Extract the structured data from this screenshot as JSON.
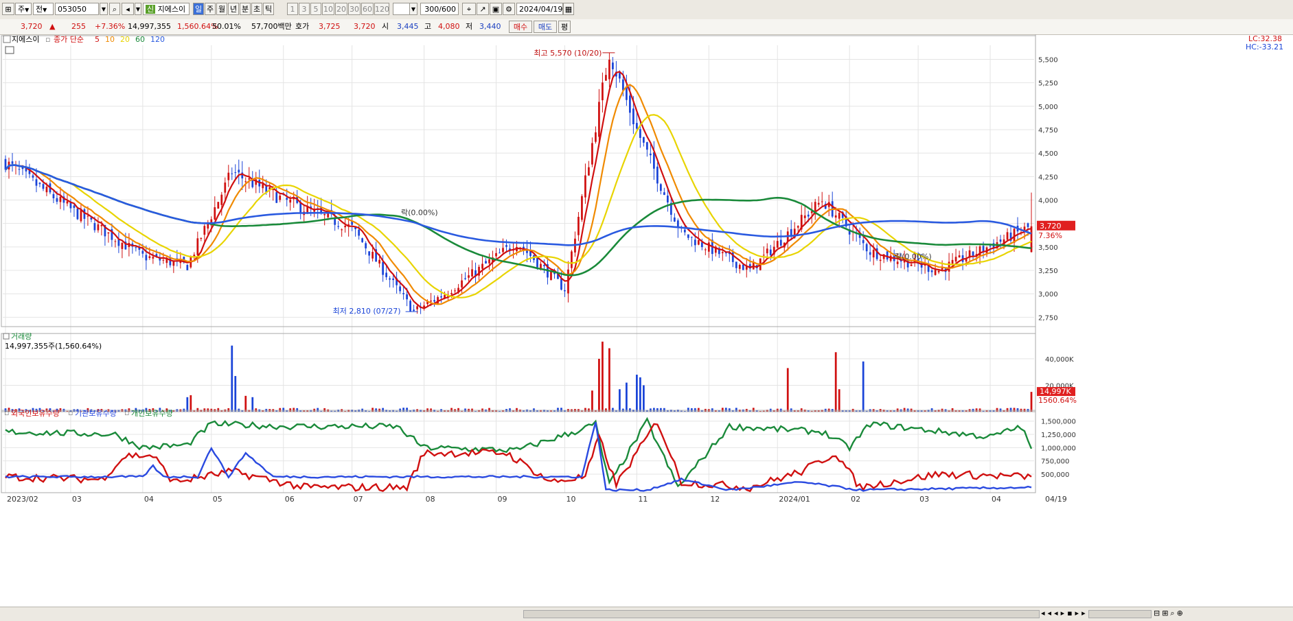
{
  "toolbar": {
    "period_label": "주",
    "market_label": "전",
    "code": "053050",
    "stock_name": "지에스이",
    "stock_badge": "신",
    "intervals": [
      "일",
      "주",
      "월",
      "년",
      "분",
      "초",
      "틱"
    ],
    "selected_interval": "일",
    "minute_steps": [
      "1",
      "3",
      "5",
      "10",
      "20",
      "30",
      "60",
      "120"
    ],
    "bar_count": "300/600",
    "date": "2024/04/19"
  },
  "quote": {
    "price": "3,720",
    "change_arrow": "▲",
    "change": "255",
    "change_pct": "+7.36%",
    "volume": "14,997,355",
    "volume_ratio": "1,560.64%",
    "turnover_pct": "50.01%",
    "amount": "57,700백만",
    "bid_label": "호가",
    "ask_price": "3,725",
    "bid_price": "3,720",
    "open_label": "시",
    "open": "3,445",
    "high_label": "고",
    "high": "4,080",
    "low_label": "저",
    "low": "3,440",
    "buy_label": "매수",
    "sell_label": "매도",
    "eval_label": "평"
  },
  "price_pane": {
    "legend_name": "지에스이",
    "legend_ma_prefix": "종가 단순",
    "legend_ma": [
      {
        "label": "5",
        "color": "#d01010"
      },
      {
        "label": "10",
        "color": "#f08a00"
      },
      {
        "label": "20",
        "color": "#e8d400"
      },
      {
        "label": "60",
        "color": "#1a8a3a"
      },
      {
        "label": "120",
        "color": "#2a5ae0"
      }
    ],
    "lc": "LC:32.38",
    "hc": "HC:-33.21",
    "max_label": "최고 5,570 (10/20)",
    "min_label": "최저 2,810 (07/27)",
    "annot1": "락(0.00%)",
    "annot2": "락(0.00%)",
    "price_tag": "3,720",
    "price_tag_pct": "7.36%"
  },
  "volume_pane": {
    "title": "거래량",
    "value_label": "14,997,355주(1,560.64%)",
    "tag": "14,997K",
    "tag_pct": "1560.64%"
  },
  "holding_pane": {
    "legend": [
      {
        "label": "외국인보유수량",
        "color": "#d01010"
      },
      {
        "label": "기관보유수량",
        "color": "#2a4ae0"
      },
      {
        "label": "개인보유수량",
        "color": "#1a8a3a"
      }
    ]
  },
  "x_axis": {
    "labels": [
      "2023/02",
      "03",
      "04",
      "05",
      "06",
      "07",
      "08",
      "09",
      "10",
      "11",
      "12",
      "2024/01",
      "02",
      "03",
      "04",
      "04/19"
    ]
  },
  "chart_data": [
    {
      "type": "candlestick",
      "title": "지에스이",
      "y_ticks": [
        2750,
        3000,
        3250,
        3500,
        3750,
        4000,
        4250,
        4500,
        4750,
        5000,
        5250,
        5500
      ],
      "ylim": [
        2650,
        5650
      ],
      "key_points": [
        {
          "date": "2023-02-01",
          "close": 4400
        },
        {
          "date": "2023-03-01",
          "close": 3900
        },
        {
          "date": "2023-04-01",
          "close": 3400
        },
        {
          "date": "2023-04-20",
          "close": 3300
        },
        {
          "date": "2023-05-10",
          "close": 4300
        },
        {
          "date": "2023-06-01",
          "close": 4000
        },
        {
          "date": "2023-07-01",
          "close": 3700
        },
        {
          "date": "2023-07-27",
          "low": 2810
        },
        {
          "date": "2023-08-10",
          "close": 3000
        },
        {
          "date": "2023-09-10",
          "close": 3550
        },
        {
          "date": "2023-10-01",
          "close": 3050
        },
        {
          "date": "2023-10-20",
          "high": 5570
        },
        {
          "date": "2023-11-01",
          "close": 4750
        },
        {
          "date": "2023-11-20",
          "close": 3650
        },
        {
          "date": "2023-12-20",
          "close": 3250
        },
        {
          "date": "2024-01-20",
          "close": 4000
        },
        {
          "date": "2024-02-10",
          "close": 3450
        },
        {
          "date": "2024-03-10",
          "close": 3250
        },
        {
          "date": "2024-04-19",
          "close": 3720,
          "open": 3445,
          "high": 4080,
          "low": 3440
        }
      ],
      "max": {
        "value": 5570,
        "date": "10/20"
      },
      "min": {
        "value": 2810,
        "date": "07/27"
      },
      "last_close": 3720,
      "moving_averages": [
        5,
        10,
        20,
        60,
        120
      ]
    },
    {
      "type": "bar",
      "title": "거래량",
      "y_ticks": [
        20000,
        40000
      ],
      "y_tick_labels": [
        "20,000K",
        "40,000K"
      ],
      "last_value": 14997355
    },
    {
      "type": "line",
      "series": [
        {
          "name": "외국인보유수량",
          "color": "#d01010"
        },
        {
          "name": "기관보유수량",
          "color": "#2a4ae0"
        },
        {
          "name": "개인보유수량",
          "color": "#1a8a3a"
        }
      ],
      "y_ticks": [
        500000,
        750000,
        1000000,
        1250000,
        1500000
      ],
      "y_tick_labels": [
        "500,000",
        "750,000",
        "1,000,000",
        "1,250,000",
        "1,500,000"
      ]
    }
  ]
}
